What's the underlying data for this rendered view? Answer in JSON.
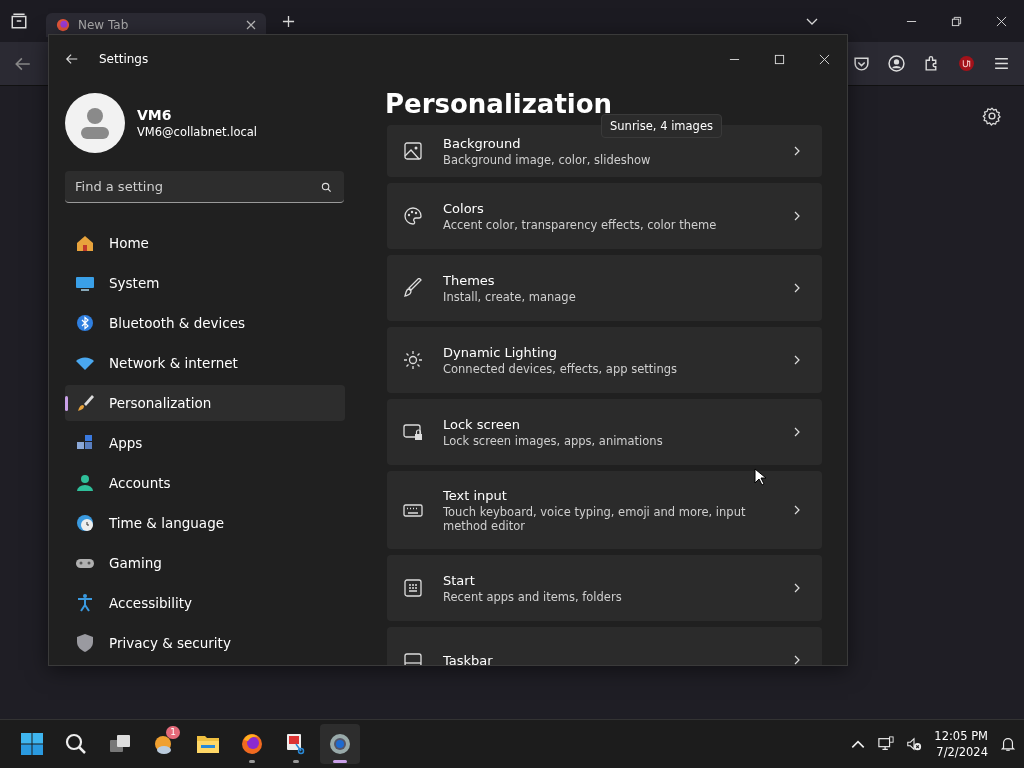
{
  "browser": {
    "tabs": [
      {
        "title": "New Tab",
        "selected": true
      }
    ]
  },
  "settings": {
    "title": "Settings",
    "user": {
      "name": "VM6",
      "email": "VM6@collabnet.local"
    },
    "search": {
      "placeholder": "Find a setting"
    },
    "nav": [
      {
        "label": "Home",
        "kind": "home",
        "selected": false
      },
      {
        "label": "System",
        "kind": "system",
        "selected": false
      },
      {
        "label": "Bluetooth & devices",
        "kind": "bluetooth",
        "selected": false
      },
      {
        "label": "Network & internet",
        "kind": "network",
        "selected": false
      },
      {
        "label": "Personalization",
        "kind": "brush",
        "selected": true
      },
      {
        "label": "Apps",
        "kind": "apps",
        "selected": false
      },
      {
        "label": "Accounts",
        "kind": "accounts",
        "selected": false
      },
      {
        "label": "Time & language",
        "kind": "time",
        "selected": false
      },
      {
        "label": "Gaming",
        "kind": "gaming",
        "selected": false
      },
      {
        "label": "Accessibility",
        "kind": "accessibility",
        "selected": false
      },
      {
        "label": "Privacy & security",
        "kind": "privacy",
        "selected": false
      }
    ],
    "page_title": "Personalization",
    "tooltip": "Sunrise, 4 images",
    "cards": [
      {
        "title": "Background",
        "description": "Background image, color, slideshow",
        "kind": "image"
      },
      {
        "title": "Colors",
        "description": "Accent color, transparency effects, color theme",
        "kind": "palette"
      },
      {
        "title": "Themes",
        "description": "Install, create, manage",
        "kind": "brush"
      },
      {
        "title": "Dynamic Lighting",
        "description": "Connected devices, effects, app settings",
        "kind": "light"
      },
      {
        "title": "Lock screen",
        "description": "Lock screen images, apps, animations",
        "kind": "lock"
      },
      {
        "title": "Text input",
        "description": "Touch keyboard, voice typing, emoji and more, input method editor",
        "kind": "keyboard"
      },
      {
        "title": "Start",
        "description": "Recent apps and items, folders",
        "kind": "start"
      },
      {
        "title": "Taskbar",
        "kind": "taskbar"
      }
    ]
  },
  "taskbar": {
    "apps": [
      {
        "kind": "start",
        "running": false,
        "active": false
      },
      {
        "kind": "search",
        "running": false,
        "active": false
      },
      {
        "kind": "taskview",
        "running": false,
        "active": false
      },
      {
        "kind": "weather",
        "badge": "1",
        "running": false,
        "active": false
      },
      {
        "kind": "folder",
        "running": false,
        "active": false
      },
      {
        "kind": "browser",
        "running": true,
        "active": false
      },
      {
        "kind": "snip",
        "running": true,
        "active": false
      },
      {
        "kind": "gear",
        "running": true,
        "active": true
      }
    ],
    "time": "12:05 PM",
    "date": "7/2/2024"
  }
}
